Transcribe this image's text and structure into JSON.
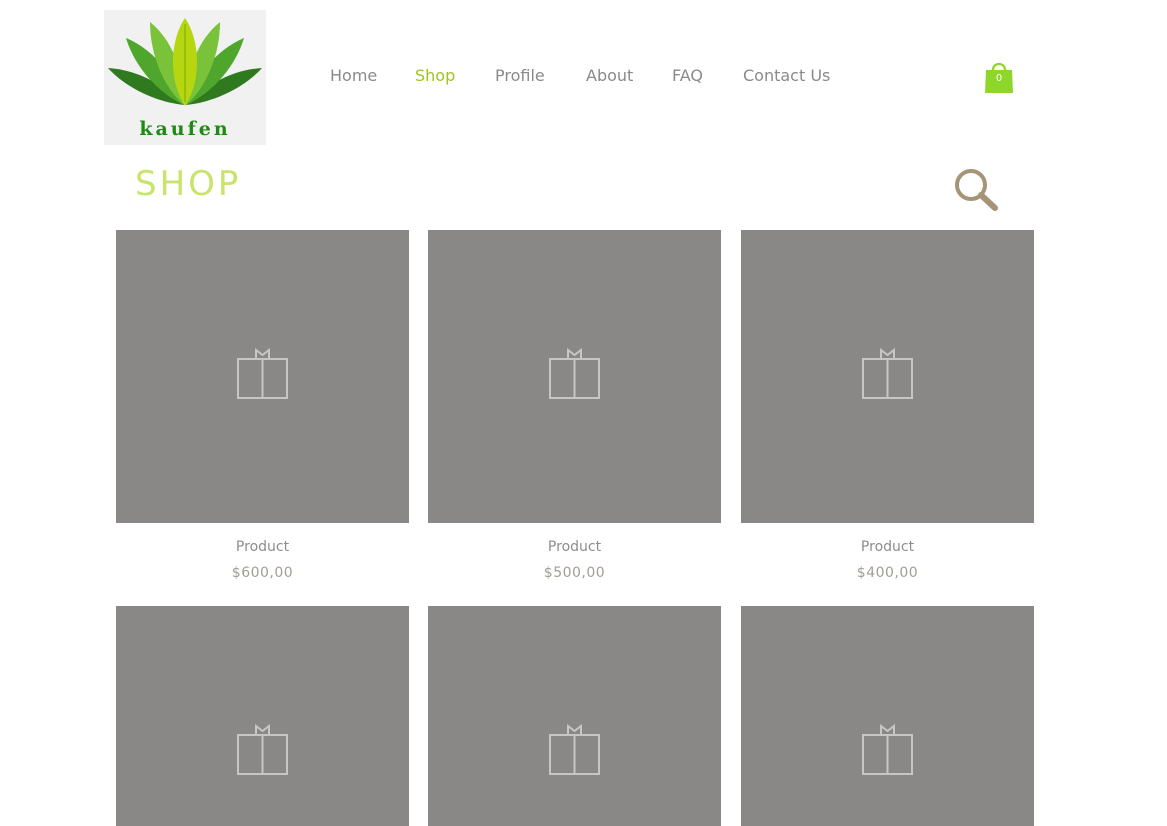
{
  "logo": {
    "text": "kaufen",
    "icon": "lotus-leaf-logo"
  },
  "nav": {
    "items": [
      {
        "label": "Home",
        "active": false
      },
      {
        "label": "Shop",
        "active": true
      },
      {
        "label": "Profile",
        "active": false
      },
      {
        "label": "About",
        "active": false
      },
      {
        "label": "FAQ",
        "active": false
      },
      {
        "label": "Contact Us",
        "active": false
      }
    ]
  },
  "cart": {
    "count": "0",
    "icon": "shopping-bag-icon"
  },
  "shop": {
    "title": "SHOP",
    "search_icon": "search-icon"
  },
  "products": [
    {
      "name": "Product",
      "price": "$600,00",
      "icon": "gift-box-icon"
    },
    {
      "name": "Product",
      "price": "$500,00",
      "icon": "gift-box-icon"
    },
    {
      "name": "Product",
      "price": "$400,00",
      "icon": "gift-box-icon"
    },
    {
      "name": "",
      "price": "",
      "icon": "gift-box-icon"
    },
    {
      "name": "",
      "price": "",
      "icon": "gift-box-icon"
    },
    {
      "name": "",
      "price": "",
      "icon": "gift-box-icon"
    }
  ],
  "colors": {
    "accent": "#9bc51f",
    "nav_text": "#8a8a8a",
    "placeholder": "#8a8886",
    "search": "#a59476",
    "cart": "#8fd62b"
  }
}
